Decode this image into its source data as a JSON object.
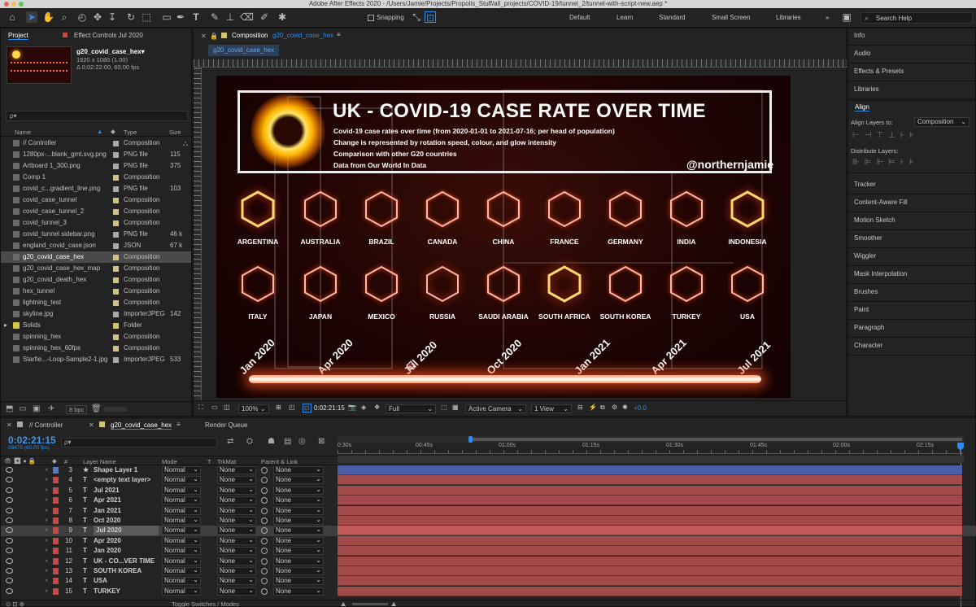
{
  "window": {
    "title": "Adobe After Effects 2020 - /Users/Jamie/Projects/Propolis_Stuff/all_projects/COVID-19/tunnel_2/tunnel-with-script-new.aep *"
  },
  "toolbar": {
    "snapping": "Snapping",
    "workspaces": [
      "Default",
      "Learn",
      "Standard",
      "Small Screen",
      "Libraries"
    ],
    "search_placeholder": "Search Help"
  },
  "project": {
    "tab": "Project",
    "effect_tab": "Effect Controls Jul 2020",
    "comp_name": "g20_covid_case_hex▾",
    "comp_res": "1920 x 1080 (1.00)",
    "comp_dur": "Δ 0:02:22:00, 60.00 fps",
    "search_placeholder": "ρ▾",
    "columns": {
      "name": "Name",
      "type": "Type",
      "size": "Size"
    },
    "items": [
      {
        "name": "// Controller",
        "type": "Composition",
        "size": "",
        "color": "#a8a8a8"
      },
      {
        "name": "1280px-...blank_gmt.svg.png",
        "type": "PNG file",
        "size": "115",
        "color": "#a8a8a8"
      },
      {
        "name": "Artboard 1_300.png",
        "type": "PNG file",
        "size": "375",
        "color": "#a8a8a8"
      },
      {
        "name": "Comp 1",
        "type": "Composition",
        "size": "",
        "color": "#d2c27a"
      },
      {
        "name": "covid_c...gradient_line.png",
        "type": "PNG file",
        "size": "103",
        "color": "#a8a8a8"
      },
      {
        "name": "covid_case_tunnel",
        "type": "Composition",
        "size": "",
        "color": "#d2c27a"
      },
      {
        "name": "covid_case_tunnel_2",
        "type": "Composition",
        "size": "",
        "color": "#d2c27a"
      },
      {
        "name": "covid_tunnel_3",
        "type": "Composition",
        "size": "",
        "color": "#d2c27a"
      },
      {
        "name": "covid_tunnel sidebar.png",
        "type": "PNG file",
        "size": "46 k",
        "color": "#a8a8a8"
      },
      {
        "name": "england_covid_case.json",
        "type": "JSON",
        "size": "67 k",
        "color": "#a8a8a8"
      },
      {
        "name": "g20_covid_case_hex",
        "type": "Composition",
        "size": "",
        "color": "#d2c27a"
      },
      {
        "name": "g20_covid_case_hex_map",
        "type": "Composition",
        "size": "",
        "color": "#d2c27a"
      },
      {
        "name": "g20_covid_death_hex",
        "type": "Composition",
        "size": "",
        "color": "#d2c27a"
      },
      {
        "name": "hex_tunnel",
        "type": "Composition",
        "size": "",
        "color": "#d2c27a"
      },
      {
        "name": "lightning_test",
        "type": "Composition",
        "size": "",
        "color": "#d2c27a"
      },
      {
        "name": "skyline.jpg",
        "type": "ImporterJPEG",
        "size": "142",
        "color": "#a8a8a8"
      },
      {
        "name": "Solids",
        "type": "Folder",
        "size": "",
        "color": "#d8c64a"
      },
      {
        "name": "spinning_hex",
        "type": "Composition",
        "size": "",
        "color": "#d2c27a"
      },
      {
        "name": "spinning_hex_60fps",
        "type": "Composition",
        "size": "",
        "color": "#d2c27a"
      },
      {
        "name": "Starfie...-Loop-Sample2-1.jpg",
        "type": "ImporterJPEG",
        "size": "533",
        "color": "#a8a8a8"
      }
    ],
    "bpc": "8 bpc"
  },
  "composition": {
    "tab": "Composition",
    "tab_name": "g20_covid_case_hex",
    "subtab": "g20_covid_case_hex",
    "title": "UK - COVID-19 CASE RATE OVER TIME",
    "lines": [
      "Covid-19 case rates over time (from 2020-01-01 to 2021-07-16; per head of population)",
      "Change is represented by rotation speed, colour, and glow intensity",
      "Comparison with other G20 countries",
      "Data from Our World In Data"
    ],
    "handle": "@northernjamie",
    "countries_row1": [
      "ARGENTINA",
      "AUSTRALIA",
      "BRAZIL",
      "CANADA",
      "CHINA",
      "FRANCE",
      "GERMANY",
      "INDIA",
      "INDONESIA"
    ],
    "countries_row2": [
      "ITALY",
      "JAPAN",
      "MEXICO",
      "RUSSIA",
      "SAUDI ARABIA",
      "SOUTH AFRICA",
      "SOUTH KOREA",
      "TURKEY",
      "USA"
    ],
    "dates": [
      "Jan 2020",
      "Apr 2020",
      "Jul 2020",
      "Oct 2020",
      "Jan 2021",
      "Apr 2021",
      "Jul 2021"
    ],
    "footer": {
      "zoom": "100%",
      "time": "0:02:21:15",
      "quality": "Full",
      "camera": "Active Camera",
      "view": "1 View",
      "exposure": "+0.0"
    }
  },
  "right_panel": {
    "items_top": [
      "Info",
      "Audio",
      "Effects & Presets",
      "Libraries"
    ],
    "align": {
      "title": "Align",
      "layers_to": "Align Layers to:",
      "target": "Composition",
      "distribute": "Distribute Layers:"
    },
    "items_bottom": [
      "Tracker",
      "Content-Aware Fill",
      "Motion Sketch",
      "Smoother",
      "Wiggler",
      "Mask Interpolation",
      "Brushes",
      "Paint",
      "Paragraph",
      "Character"
    ]
  },
  "timeline": {
    "tabs": [
      "// Controller",
      "g20_covid_case_hex",
      "Render Queue"
    ],
    "timecode": "0:02:21:15",
    "frames": "08475 (60.00 fps)",
    "columns": {
      "layer": "Layer Name",
      "mode": "Mode",
      "t": "T",
      "trkmat": "TrkMat",
      "parent": "Parent & Link"
    },
    "ruler": [
      ":00s",
      "00:45s",
      "01:00s",
      "01:15s",
      "01:30s",
      "01:45s",
      "02:00s",
      "02:15s"
    ],
    "ruler_first": "0:30s",
    "layers": [
      {
        "num": "3",
        "type": "★",
        "name": "Shape Layer 1",
        "mode": "Normal",
        "trk": "None",
        "parent": "None",
        "color": "#5a78c8"
      },
      {
        "num": "4",
        "type": "T",
        "name": "<empty text layer>",
        "mode": "Normal",
        "trk": "None",
        "parent": "None",
        "color": "#c84848"
      },
      {
        "num": "5",
        "type": "T",
        "name": "Jul 2021",
        "mode": "Normal",
        "trk": "None",
        "parent": "None",
        "color": "#c84848"
      },
      {
        "num": "6",
        "type": "T",
        "name": "Apr 2021",
        "mode": "Normal",
        "trk": "None",
        "parent": "None",
        "color": "#c84848"
      },
      {
        "num": "7",
        "type": "T",
        "name": "Jan 2021",
        "mode": "Normal",
        "trk": "None",
        "parent": "None",
        "color": "#c84848"
      },
      {
        "num": "8",
        "type": "T",
        "name": "Oct 2020",
        "mode": "Normal",
        "trk": "None",
        "parent": "None",
        "color": "#c84848"
      },
      {
        "num": "9",
        "type": "T",
        "name": "Jul 2020",
        "mode": "Normal",
        "trk": "None",
        "parent": "None",
        "color": "#c84848"
      },
      {
        "num": "10",
        "type": "T",
        "name": "Apr 2020",
        "mode": "Normal",
        "trk": "None",
        "parent": "None",
        "color": "#c84848"
      },
      {
        "num": "11",
        "type": "T",
        "name": "Jan 2020",
        "mode": "Normal",
        "trk": "None",
        "parent": "None",
        "color": "#c84848"
      },
      {
        "num": "12",
        "type": "T",
        "name": "UK - CO...VER TIME",
        "mode": "Normal",
        "trk": "None",
        "parent": "None",
        "color": "#c84848"
      },
      {
        "num": "13",
        "type": "T",
        "name": "SOUTH KOREA",
        "mode": "Normal",
        "trk": "None",
        "parent": "None",
        "color": "#c84848"
      },
      {
        "num": "14",
        "type": "T",
        "name": "USA",
        "mode": "Normal",
        "trk": "None",
        "parent": "None",
        "color": "#c84848"
      },
      {
        "num": "15",
        "type": "T",
        "name": "TURKEY",
        "mode": "Normal",
        "trk": "None",
        "parent": "None",
        "color": "#c84848"
      }
    ],
    "footer": "Toggle Switches / Modes"
  },
  "colors": {
    "accent": "#2d8ceb",
    "layer_bar": "#a24a4a",
    "selected": "#4a4a4a"
  }
}
